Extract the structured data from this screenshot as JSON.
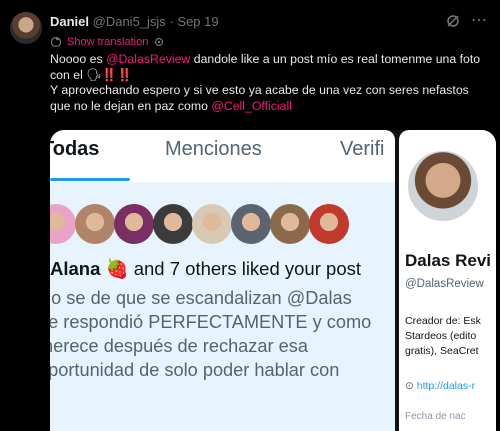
{
  "tweet": {
    "author_name": "Daniel",
    "author_handle": "@Dani5_jsjs",
    "separator": "·",
    "date": "Sep 19",
    "show_translation": "Show translation",
    "line1_pre": "Noooo es ",
    "mention1": "@DalasReview",
    "line1_post": " dandole like a un post mío es real tomenme una foto con el ",
    "emoji1": "🗣",
    "emoji2": "‼️",
    "line2": "Y aprovechando espero y si ve esto ya acabe de una vez con seres nefastos que no le dejan en paz como ",
    "mention2": "@Cell_Officiall"
  },
  "screenshot": {
    "tabs": [
      "Todas",
      "Menciones",
      "Verifi"
    ],
    "active_tab": "Todas",
    "liked_name": "Alana",
    "liked_emoji": "🍓",
    "liked_rest": "and 7 others liked your post",
    "post_lines": [
      "No se de que se escandalizan @Dalas",
      "Le respondió PERFECTAMENTE y como",
      "merece después de rechazar esa",
      "oportunidad de solo poder hablar con"
    ],
    "avatars": [
      {
        "name": "avatar-1",
        "color": "#e9a3c9"
      },
      {
        "name": "avatar-2",
        "color": "#b08468"
      },
      {
        "name": "avatar-3",
        "color": "#7b2e63"
      },
      {
        "name": "avatar-4",
        "color": "#3b3b3b"
      },
      {
        "name": "avatar-5",
        "color": "#d9c8b4"
      },
      {
        "name": "avatar-6",
        "color": "#5b6470"
      },
      {
        "name": "avatar-7",
        "color": "#8a6a4a"
      },
      {
        "name": "avatar-8",
        "color": "#c0392b"
      }
    ]
  },
  "profile": {
    "name": "Dalas Revi",
    "handle": "@DalasReview",
    "bio_lines": [
      "Creador de: Esk",
      "Stardeos (edito",
      "gratis), SeaCret"
    ],
    "link": "http://dalas-r",
    "date_line": "Fecha de nac"
  },
  "colors": {
    "accent": "#f91880",
    "link_blue": "#1d9bf0",
    "tab_indicator": "#1d9bf0"
  }
}
